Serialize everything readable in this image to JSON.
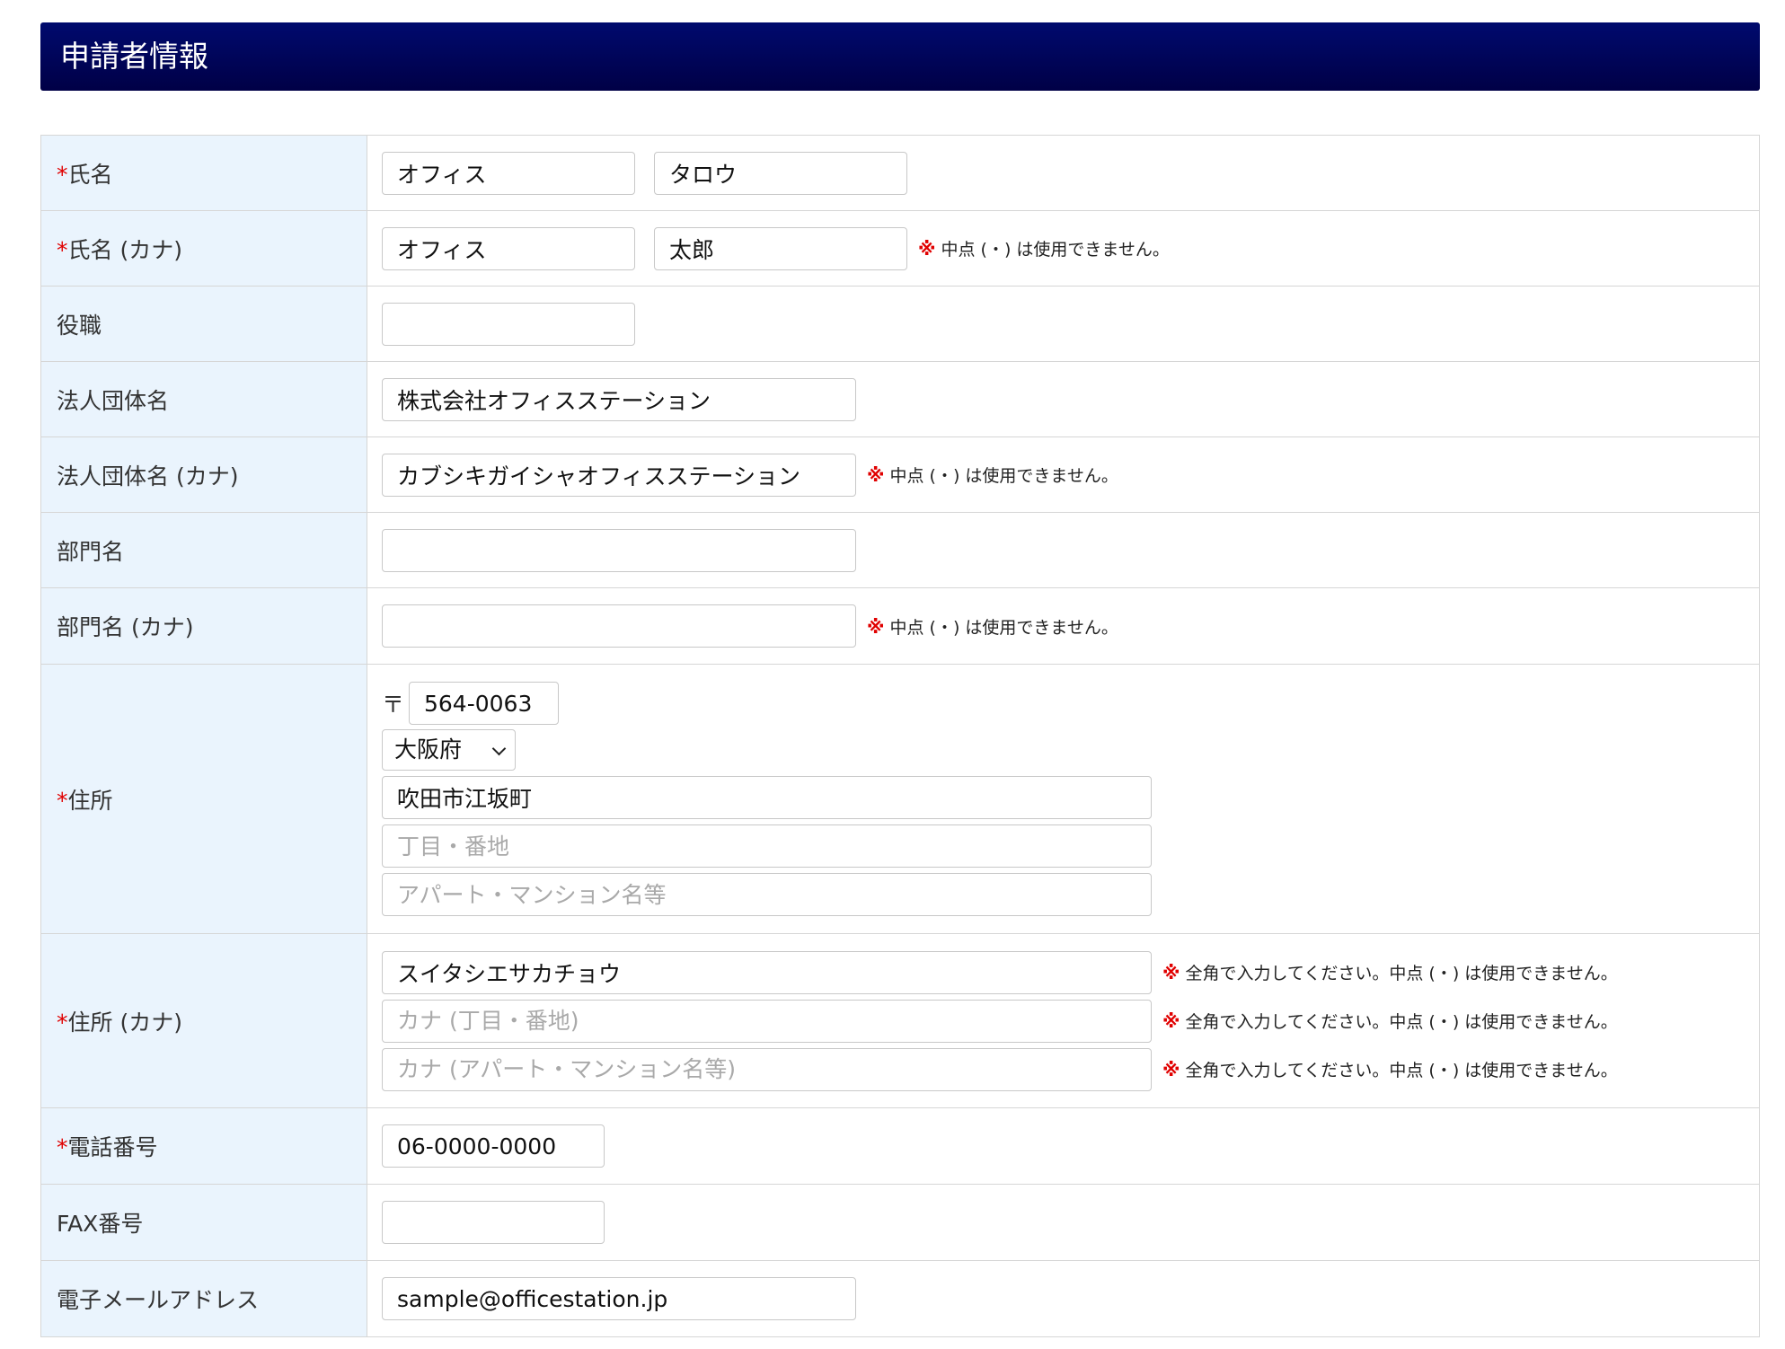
{
  "section": {
    "title": "申請者情報"
  },
  "required_mark": "*",
  "notes": {
    "mark": "※",
    "no_middle_dot": "中点 (・) は使用できません。",
    "zenkaku_no_middle_dot": "全角で入力してください。中点 (・) は使用できません。"
  },
  "rows": {
    "name": {
      "label": "氏名",
      "last": "オフィス",
      "first": "タロウ"
    },
    "name_kana": {
      "label": "氏名 (カナ)",
      "last": "オフィス",
      "first": "太郎"
    },
    "position": {
      "label": "役職",
      "value": ""
    },
    "company": {
      "label": "法人団体名",
      "value": "株式会社オフィスステーション"
    },
    "company_kana": {
      "label": "法人団体名 (カナ)",
      "value": "カブシキガイシャオフィスステーション"
    },
    "department": {
      "label": "部門名",
      "value": ""
    },
    "department_kana": {
      "label": "部門名 (カナ)",
      "value": ""
    },
    "address": {
      "label": "住所",
      "zip_mark": "〒",
      "zip": "564-0063",
      "prefecture": "大阪府",
      "city": "吹田市江坂町",
      "street_placeholder": "丁目・番地",
      "building_placeholder": "アパート・マンション名等"
    },
    "address_kana": {
      "label": "住所 (カナ)",
      "city": "スイタシエサカチョウ",
      "street_placeholder": "カナ (丁目・番地)",
      "building_placeholder": "カナ (アパート・マンション名等)"
    },
    "phone": {
      "label": "電話番号",
      "value": "06-0000-0000"
    },
    "fax": {
      "label": "FAX番号",
      "value": ""
    },
    "email": {
      "label": "電子メールアドレス",
      "value": "sample@officestation.jp"
    }
  }
}
